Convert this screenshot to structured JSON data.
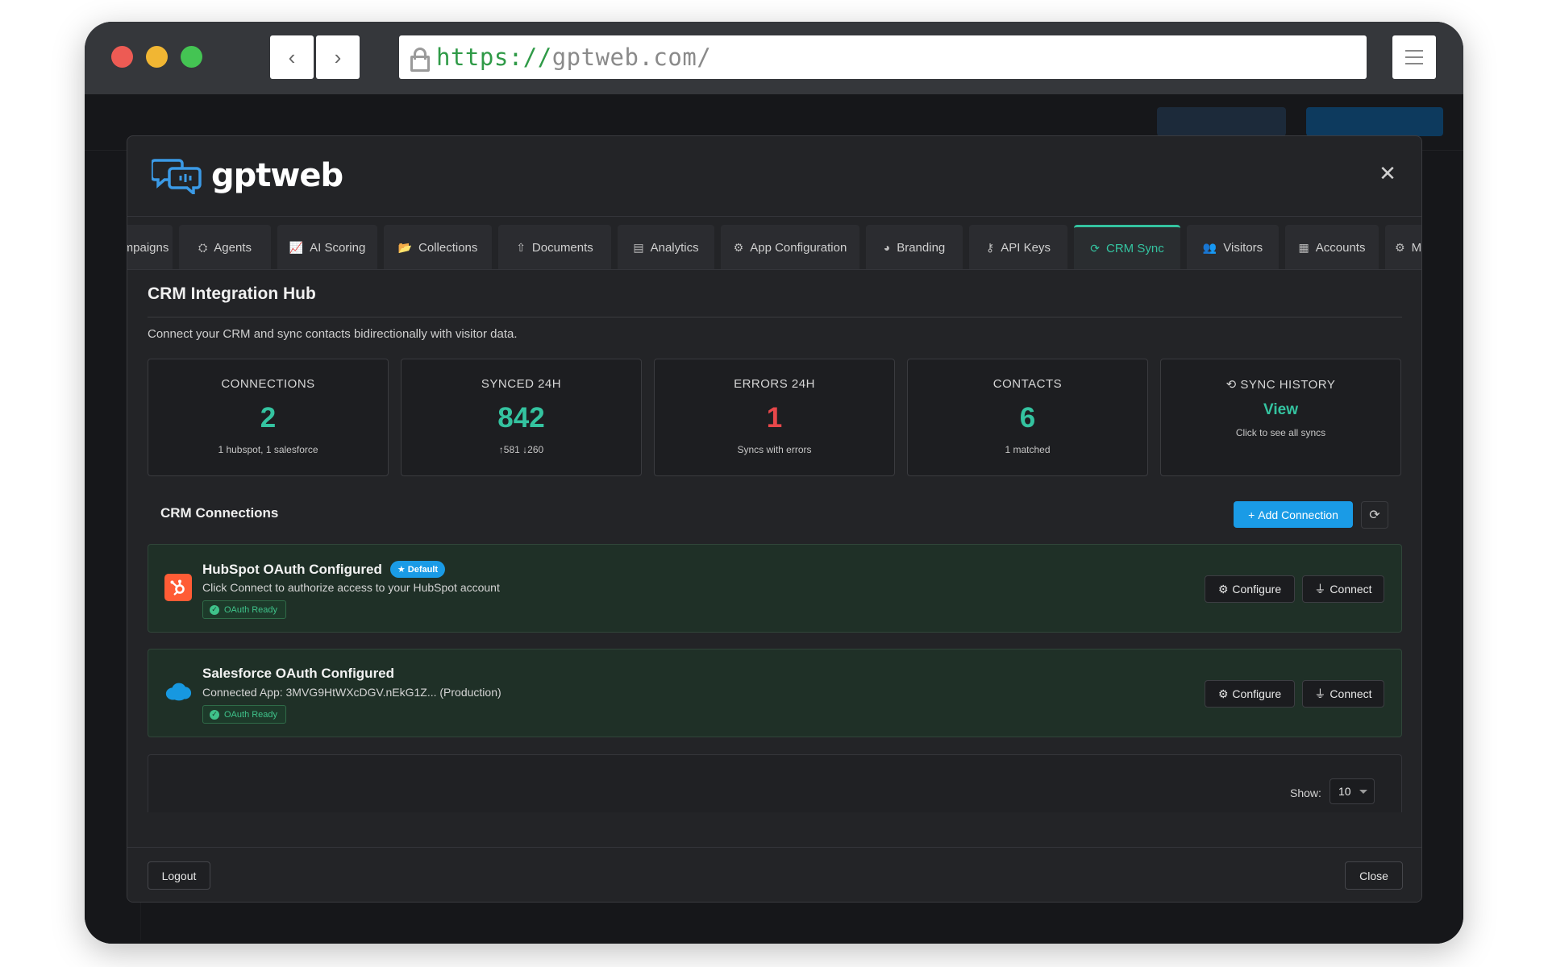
{
  "browser": {
    "url_protocol": "https://",
    "url_host": "gptweb.com/"
  },
  "modal": {
    "brand": "gptweb",
    "close_symbol": "✕",
    "tabs": [
      {
        "label": "mpaigns",
        "icon": "megaphone-icon",
        "active": false
      },
      {
        "label": "Agents",
        "icon": "agents-icon",
        "active": false
      },
      {
        "label": "AI Scoring",
        "icon": "chart-line-icon",
        "active": false
      },
      {
        "label": "Collections",
        "icon": "folder-open-icon",
        "active": false
      },
      {
        "label": "Documents",
        "icon": "upload-icon",
        "active": false
      },
      {
        "label": "Analytics",
        "icon": "chart-area-icon",
        "active": false
      },
      {
        "label": "App Configuration",
        "icon": "cog-icon",
        "active": false
      },
      {
        "label": "Branding",
        "icon": "palette-icon",
        "active": false
      },
      {
        "label": "API Keys",
        "icon": "key-icon",
        "active": false
      },
      {
        "label": "CRM Sync",
        "icon": "sync-icon",
        "active": true
      },
      {
        "label": "Visitors",
        "icon": "users-icon",
        "active": false
      },
      {
        "label": "Accounts",
        "icon": "building-icon",
        "active": false
      },
      {
        "label": "M",
        "icon": "gear-icon",
        "active": false
      }
    ],
    "hub": {
      "title": "CRM Integration Hub",
      "subtitle": "Connect your CRM and sync contacts bidirectionally with visitor data."
    },
    "stats": {
      "connections": {
        "label": "CONNECTIONS",
        "value": "2",
        "note": "1 hubspot, 1 salesforce"
      },
      "synced": {
        "label": "SYNCED 24H",
        "value": "842",
        "note": "↑581 ↓260"
      },
      "errors": {
        "label": "ERRORS 24H",
        "value": "1",
        "note": "Syncs with errors"
      },
      "contacts": {
        "label": "CONTACTS",
        "value": "6",
        "note": "1 matched"
      },
      "history": {
        "label": "SYNC HISTORY",
        "link": "View",
        "note": "Click to see all syncs"
      }
    },
    "connections": {
      "title": "CRM Connections",
      "add_label": "Add Connection",
      "items": [
        {
          "name": "HubSpot OAuth Configured",
          "badge": "Default",
          "description": "Click Connect to authorize access to your HubSpot account",
          "status": "OAuth Ready",
          "configure_label": "Configure",
          "connect_label": "Connect"
        },
        {
          "name": "Salesforce OAuth Configured",
          "description": "Connected App: 3MVG9HtWXcDGV.nEkG1Z... (Production)",
          "status": "OAuth Ready",
          "configure_label": "Configure",
          "connect_label": "Connect"
        }
      ]
    },
    "table": {
      "show_label": "Show:",
      "page_size": "10"
    },
    "footer": {
      "logout_label": "Logout",
      "close_label": "Close"
    }
  },
  "colors": {
    "accent": "#34c3a0",
    "error": "#e8474a",
    "primary": "#1a9be6",
    "hubspot": "#ff5c35",
    "salesforce": "#1798e0"
  }
}
